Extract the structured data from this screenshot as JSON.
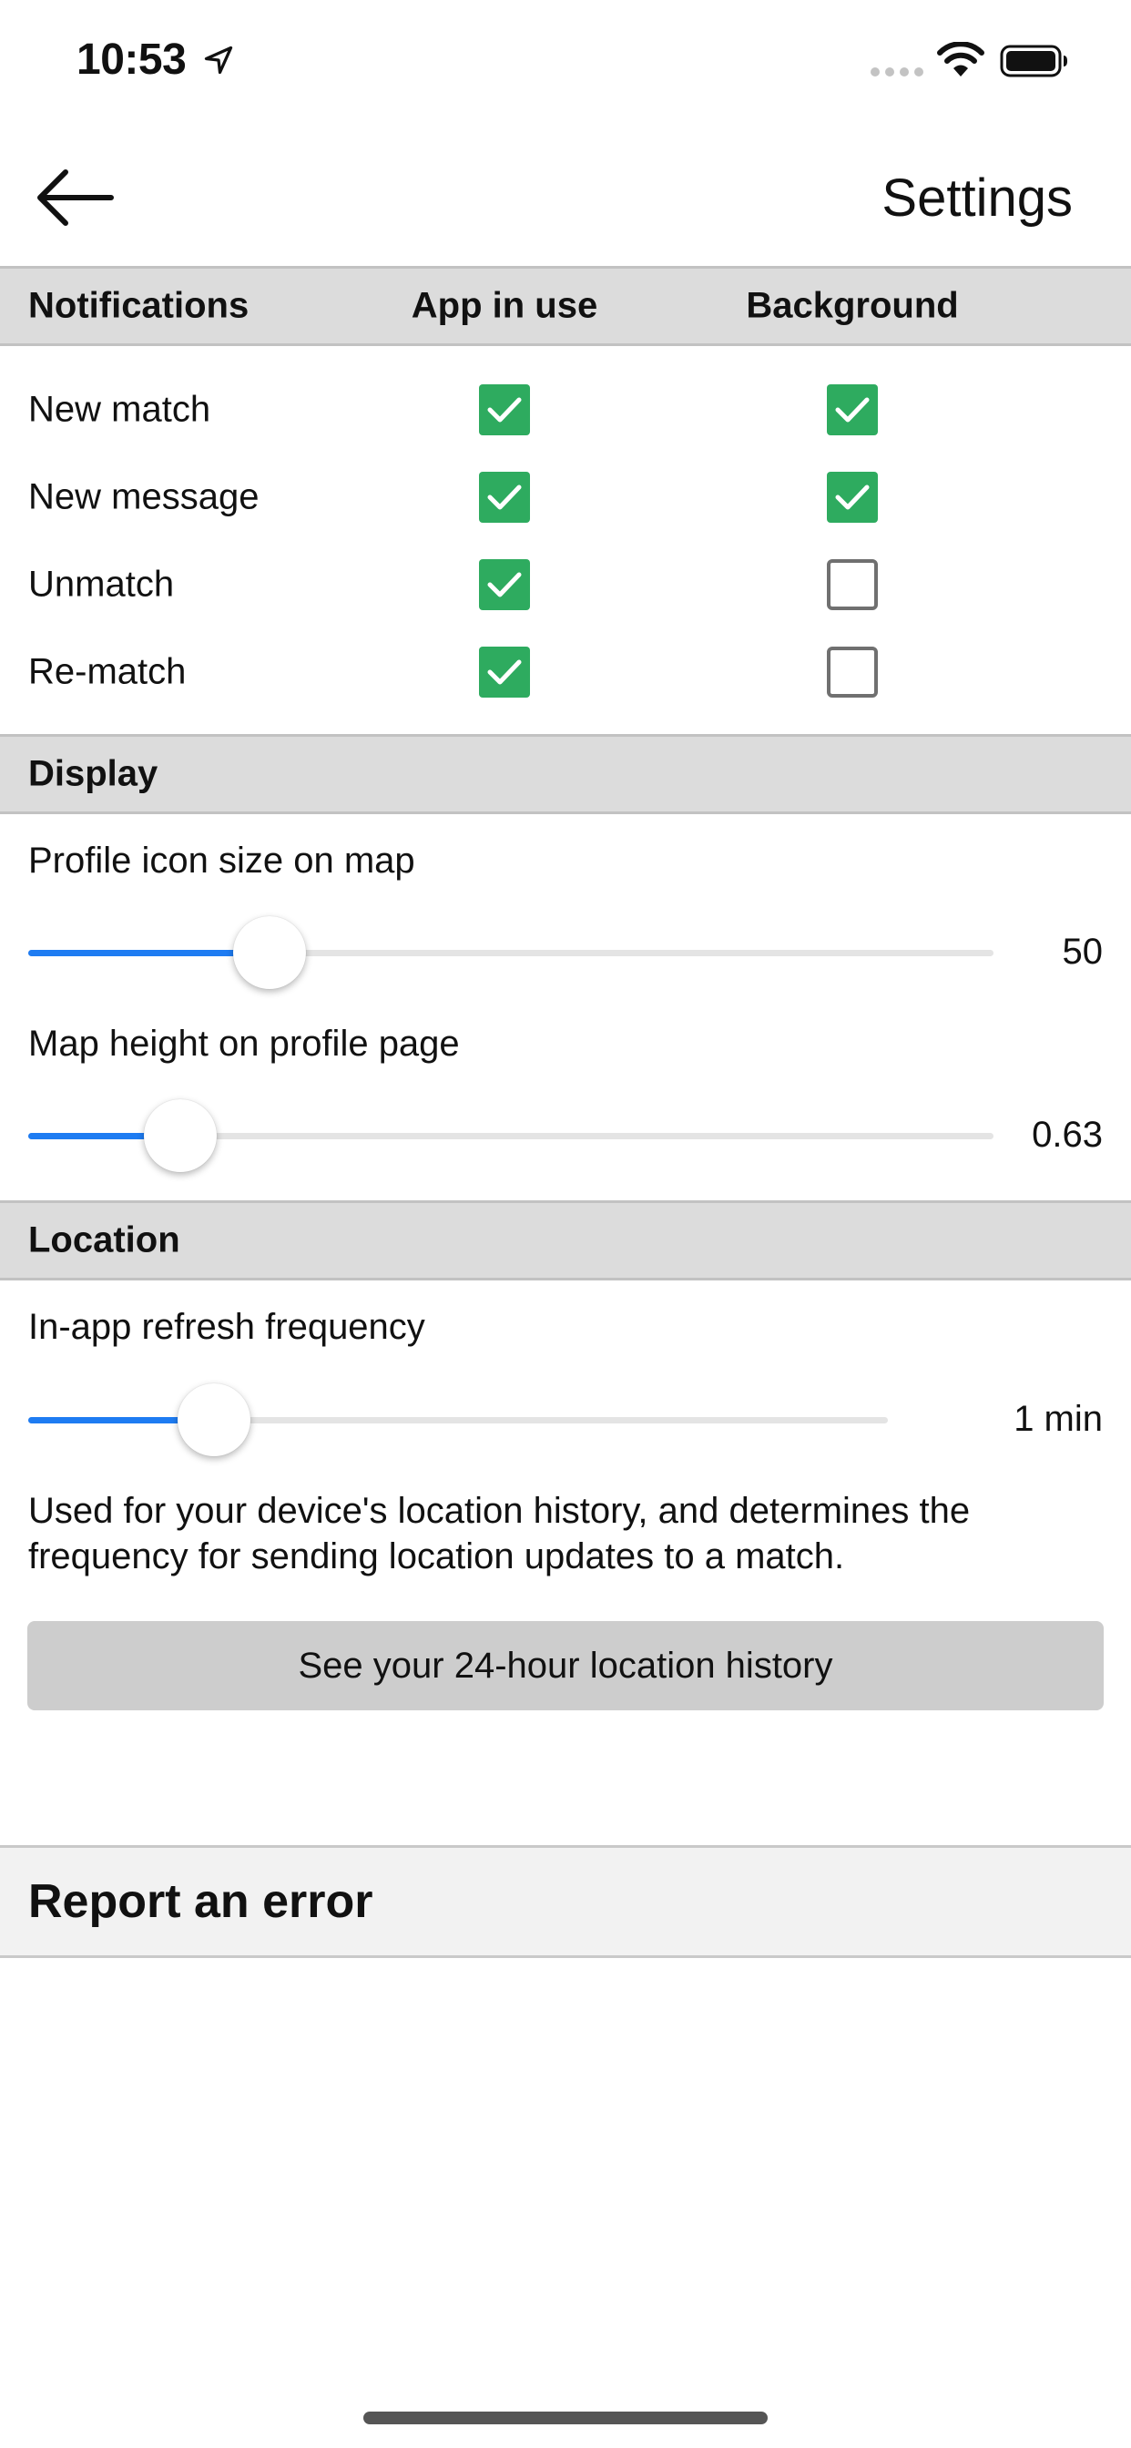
{
  "status_bar": {
    "time": "10:53"
  },
  "nav": {
    "title": "Settings"
  },
  "notifications": {
    "header": "Notifications",
    "col_app_in_use": "App in use",
    "col_background": "Background",
    "rows": [
      {
        "label": "New match",
        "app_in_use": true,
        "background": true
      },
      {
        "label": "New message",
        "app_in_use": true,
        "background": true
      },
      {
        "label": "Unmatch",
        "app_in_use": true,
        "background": false
      },
      {
        "label": "Re-match",
        "app_in_use": true,
        "background": false
      }
    ]
  },
  "display": {
    "header": "Display",
    "profile_icon_size": {
      "label": "Profile icon size on map",
      "value": "50",
      "fraction": 0.23
    },
    "map_height": {
      "label": "Map height on profile page",
      "value": "0.63",
      "fraction": 0.13
    }
  },
  "location": {
    "header": "Location",
    "refresh": {
      "label": "In-app refresh frequency",
      "value": "1 min",
      "fraction": 0.19
    },
    "help_text": "Used for your device's location history, and determines the frequency for sending location updates to a match.",
    "history_button": "See your 24-hour location history"
  },
  "report": {
    "label": "Report an error"
  },
  "colors": {
    "accent": "#1e7cf2",
    "check": "#2eab5f",
    "section_bg": "#dcdcdc"
  }
}
